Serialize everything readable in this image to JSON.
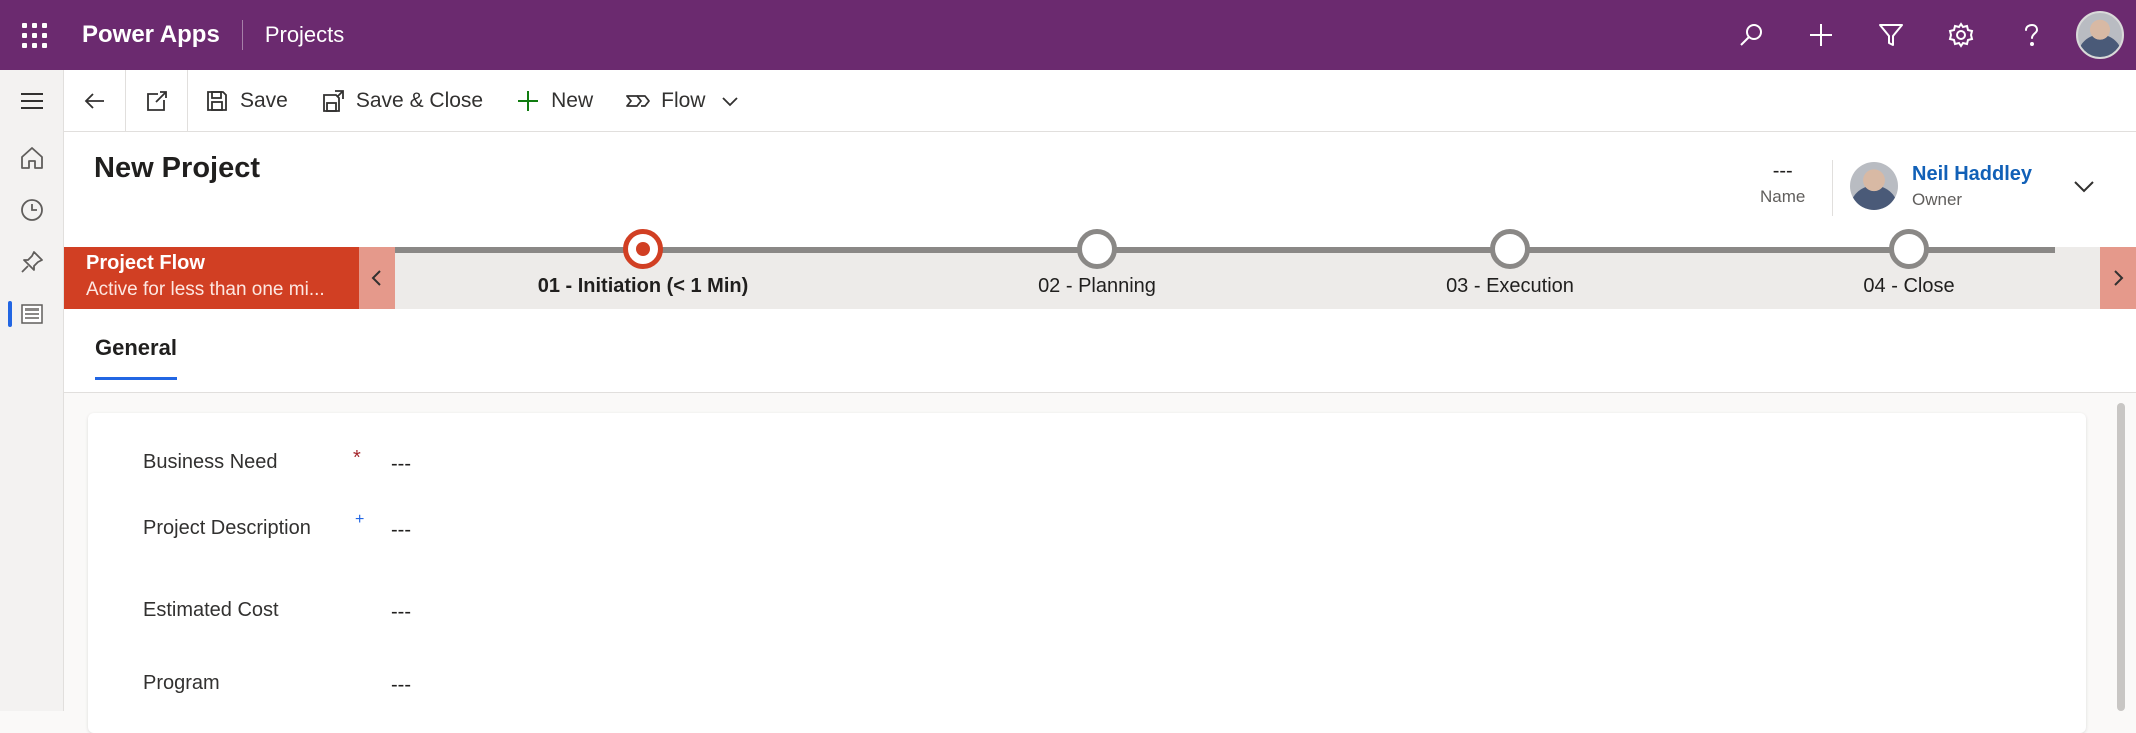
{
  "topbar": {
    "app_name": "Power Apps",
    "area_name": "Projects",
    "actions": [
      "search-icon",
      "plus-icon",
      "filter-icon",
      "gear-icon",
      "help-icon"
    ]
  },
  "leftnav": {
    "items": [
      "menu-icon",
      "home-icon",
      "recent-icon",
      "pin-icon",
      "entity-icon"
    ]
  },
  "commandbar": {
    "back_icon": "back-arrow-icon",
    "popout_icon": "popout-icon",
    "save_label": "Save",
    "save_close_label": "Save & Close",
    "new_label": "New",
    "flow_label": "Flow"
  },
  "header": {
    "title": "New Project",
    "name_value": "---",
    "name_label": "Name",
    "owner_name": "Neil Haddley",
    "owner_label": "Owner"
  },
  "bpf": {
    "process_name": "Project Flow",
    "status": "Active for less than one mi...",
    "stages": [
      {
        "label": "01 - Initiation  (< 1 Min)",
        "active": true
      },
      {
        "label": "02 - Planning",
        "active": false
      },
      {
        "label": "03 - Execution",
        "active": false
      },
      {
        "label": "04 - Close",
        "active": false
      }
    ]
  },
  "tabs": {
    "general": "General"
  },
  "form": {
    "fields": [
      {
        "label": "Business Need",
        "marker": "*",
        "value": "---"
      },
      {
        "label": "Project Description",
        "marker": "+",
        "value": "---"
      },
      {
        "label": "Estimated Cost",
        "marker": "",
        "value": "---"
      },
      {
        "label": "Program",
        "marker": "",
        "value": "---"
      }
    ]
  },
  "colors": {
    "topbar": "#6b2a6f",
    "bpf_flag": "#d13f23",
    "accent": "#2266e3",
    "owner_link": "#1160b7"
  }
}
